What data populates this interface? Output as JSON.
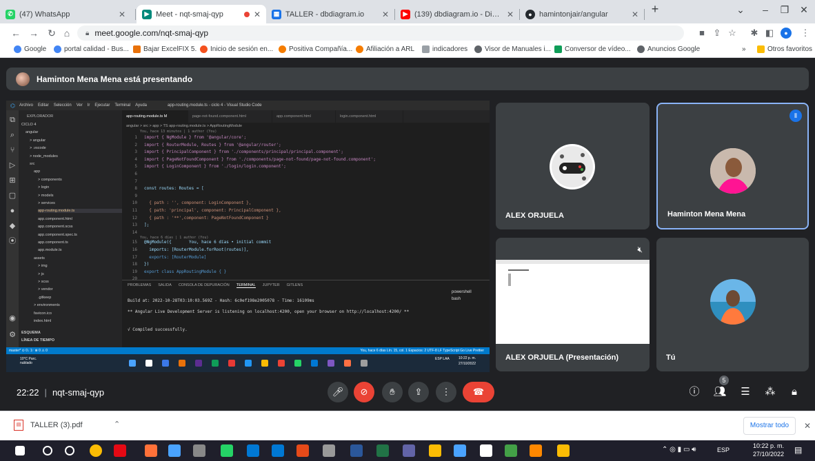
{
  "browser": {
    "tabs": [
      {
        "title": "(47) WhatsApp",
        "icon": "whatsapp-icon",
        "color": "#25d366"
      },
      {
        "title": "Meet - nqt-smaj-qyp",
        "icon": "meet-icon",
        "color": "#00897b",
        "active": true
      },
      {
        "title": "TALLER - dbdiagram.io",
        "icon": "dbdiagram-icon",
        "color": "#1a73e8"
      },
      {
        "title": "(139) dbdiagram.io - Diagramas",
        "icon": "youtube-icon",
        "color": "#ff0000"
      },
      {
        "title": "hamintonjair/angular",
        "icon": "github-icon",
        "color": "#24292e"
      }
    ],
    "new_tab": "+",
    "url": "meet.google.com/nqt-smaj-qyp",
    "bookmarks": [
      {
        "label": "Google",
        "color": "#4285f4"
      },
      {
        "label": "portal calidad - Bus...",
        "color": "#4285f4"
      },
      {
        "label": "Bajar ExcelFIX 5.",
        "color": "#e8710a"
      },
      {
        "label": "Inicio de sesión en...",
        "color": "#f4511e"
      },
      {
        "label": "Positiva Compañía...",
        "color": "#f57c00"
      },
      {
        "label": "Afiliación a ARL",
        "color": "#f57c00"
      },
      {
        "label": "indicadores",
        "color": "#9aa0a6"
      },
      {
        "label": "Visor de Manuales i...",
        "color": "#5f6368"
      },
      {
        "label": "Conversor de vídeo...",
        "color": "#0f9d58"
      },
      {
        "label": "Anuncios Google",
        "color": "#5f6368"
      }
    ],
    "bookmarks_more": "»",
    "other_bookmarks": "Otros favoritos"
  },
  "meet": {
    "presenting_banner": "Haminton Mena Mena está presentando",
    "meeting_time": "22:22",
    "meeting_code": "nqt-smaj-qyp",
    "participants_count": "5",
    "participants": [
      {
        "name": "ALEX ORJUELA"
      },
      {
        "name": "Haminton Mena Mena"
      },
      {
        "name": "ALEX ORJUELA (Presentación)"
      },
      {
        "name": "Tú"
      }
    ]
  },
  "vscode": {
    "menu": [
      "Archivo",
      "Editar",
      "Selección",
      "Ver",
      "Ir",
      "Ejecutar",
      "Terminal",
      "Ayuda"
    ],
    "window_title": "app-routing.module.ts - ciclo 4 - Visual Studio Code",
    "explorer_title": "EXPLORADOR",
    "tree": [
      {
        "label": "CICLO 4",
        "indent": 0
      },
      {
        "label": "angular",
        "indent": 1
      },
      {
        "label": "> angular",
        "indent": 2
      },
      {
        "label": "> .vscode",
        "indent": 2
      },
      {
        "label": "> node_modules",
        "indent": 2
      },
      {
        "label": "src",
        "indent": 2
      },
      {
        "label": "app",
        "indent": 3
      },
      {
        "label": "> components",
        "indent": 4
      },
      {
        "label": "> login",
        "indent": 4
      },
      {
        "label": "> models",
        "indent": 4
      },
      {
        "label": "> services",
        "indent": 4
      },
      {
        "label": "app-routing.module.ts",
        "indent": 4,
        "badge": "M"
      },
      {
        "label": "app.component.html",
        "indent": 4
      },
      {
        "label": "app.component.scss",
        "indent": 4
      },
      {
        "label": "app.component.spec.ts",
        "indent": 4
      },
      {
        "label": "app.component.ts",
        "indent": 4
      },
      {
        "label": "app.module.ts",
        "indent": 4
      },
      {
        "label": "assets",
        "indent": 3
      },
      {
        "label": "> img",
        "indent": 4
      },
      {
        "label": "> js",
        "indent": 4
      },
      {
        "label": "> scss",
        "indent": 4
      },
      {
        "label": "> vendor",
        "indent": 4
      },
      {
        "label": ".gitkeep",
        "indent": 4
      },
      {
        "label": "> environments",
        "indent": 3
      },
      {
        "label": "favicon.ico",
        "indent": 3
      },
      {
        "label": "index.html",
        "indent": 3
      }
    ],
    "outline": "ESQUEMA",
    "timeline": "LÍNEA DE TIEMPO",
    "tabs": [
      "app-routing.module.ts M",
      "page-not-found.component.html",
      "app.component.html",
      "login.component.html"
    ],
    "breadcrumb": "angular > src > app > TS app-routing.module.ts > AppRoutingModule",
    "blame_top": "You, hace 13 minutos | 1 author (You)",
    "code": [
      {
        "n": "1",
        "t": "import { NgModule } from '@angular/core';"
      },
      {
        "n": "2",
        "t": "import { RouterModule, Routes } from '@angular/router';"
      },
      {
        "n": "3",
        "t": "import { PrincipalComponent } from './components/principal/principal.component';"
      },
      {
        "n": "4",
        "t": "import { PageNotFoundComponent } from './components/page-not-found/page-not-found.component';"
      },
      {
        "n": "5",
        "t": "import { LoginComponent } from './login/login.component';"
      },
      {
        "n": "6",
        "t": ""
      },
      {
        "n": "7",
        "t": ""
      },
      {
        "n": "8",
        "t": "const routes: Routes = ["
      },
      {
        "n": "9",
        "t": ""
      },
      {
        "n": "10",
        "t": "  { path : '', component: LoginComponent },"
      },
      {
        "n": "11",
        "t": "  { path: 'principal', component: PrincipalComponent },"
      },
      {
        "n": "12",
        "t": "  { path : '**',component: PageNotFoundComponent }"
      },
      {
        "n": "13",
        "t": "];"
      },
      {
        "n": "14",
        "t": ""
      },
      {
        "n": "15",
        "t": "@NgModule({       You, hace 6 días • initial commit"
      },
      {
        "n": "16",
        "t": "  imports: [RouterModule.forRoot(routes)],"
      },
      {
        "n": "17",
        "t": "  exports: [RouterModule]"
      },
      {
        "n": "18",
        "t": "})"
      },
      {
        "n": "19",
        "t": "export class AppRoutingModule { }"
      },
      {
        "n": "20",
        "t": ""
      }
    ],
    "blame_mid": "You, hace 6 días | 1 author (You)",
    "terminal_tabs": [
      "PROBLEMAS",
      "SALIDA",
      "CONSOLA DE DEPURACIÓN",
      "TERMINAL",
      "JUPYTER",
      "GITLENS"
    ],
    "terminal_lines": [
      "Build at: 2022-10-28T03:10:03.569Z - Hash: 6c0ef198e2005078 - Time: 16109ms",
      "** Angular Live Development Server is listening on localhost:4200, open your browser on http://localhost:4200/ **",
      "√ Compiled successfully."
    ],
    "terminal_shells": [
      "powershell",
      "bash"
    ],
    "status_left": "master*  ⊙ 0↓ 1↑  ⊗ 0 ⚠ 0",
    "status_right": "You, hace 6 días   Lín. 15, col. 1   Espacios: 2   UTF-8   LF   TypeScript   Go Live   Prettier",
    "weather": "10°C Parc. nublado",
    "clock": "10:22 p. m.",
    "date": "27/10/2022",
    "lang": "ESP LAA"
  },
  "download": {
    "file": "TALLER (3).pdf",
    "show_all": "Mostrar todo"
  },
  "taskbar": {
    "time": "10:22 p. m.",
    "date": "27/10/2022",
    "lang": "ESP"
  }
}
